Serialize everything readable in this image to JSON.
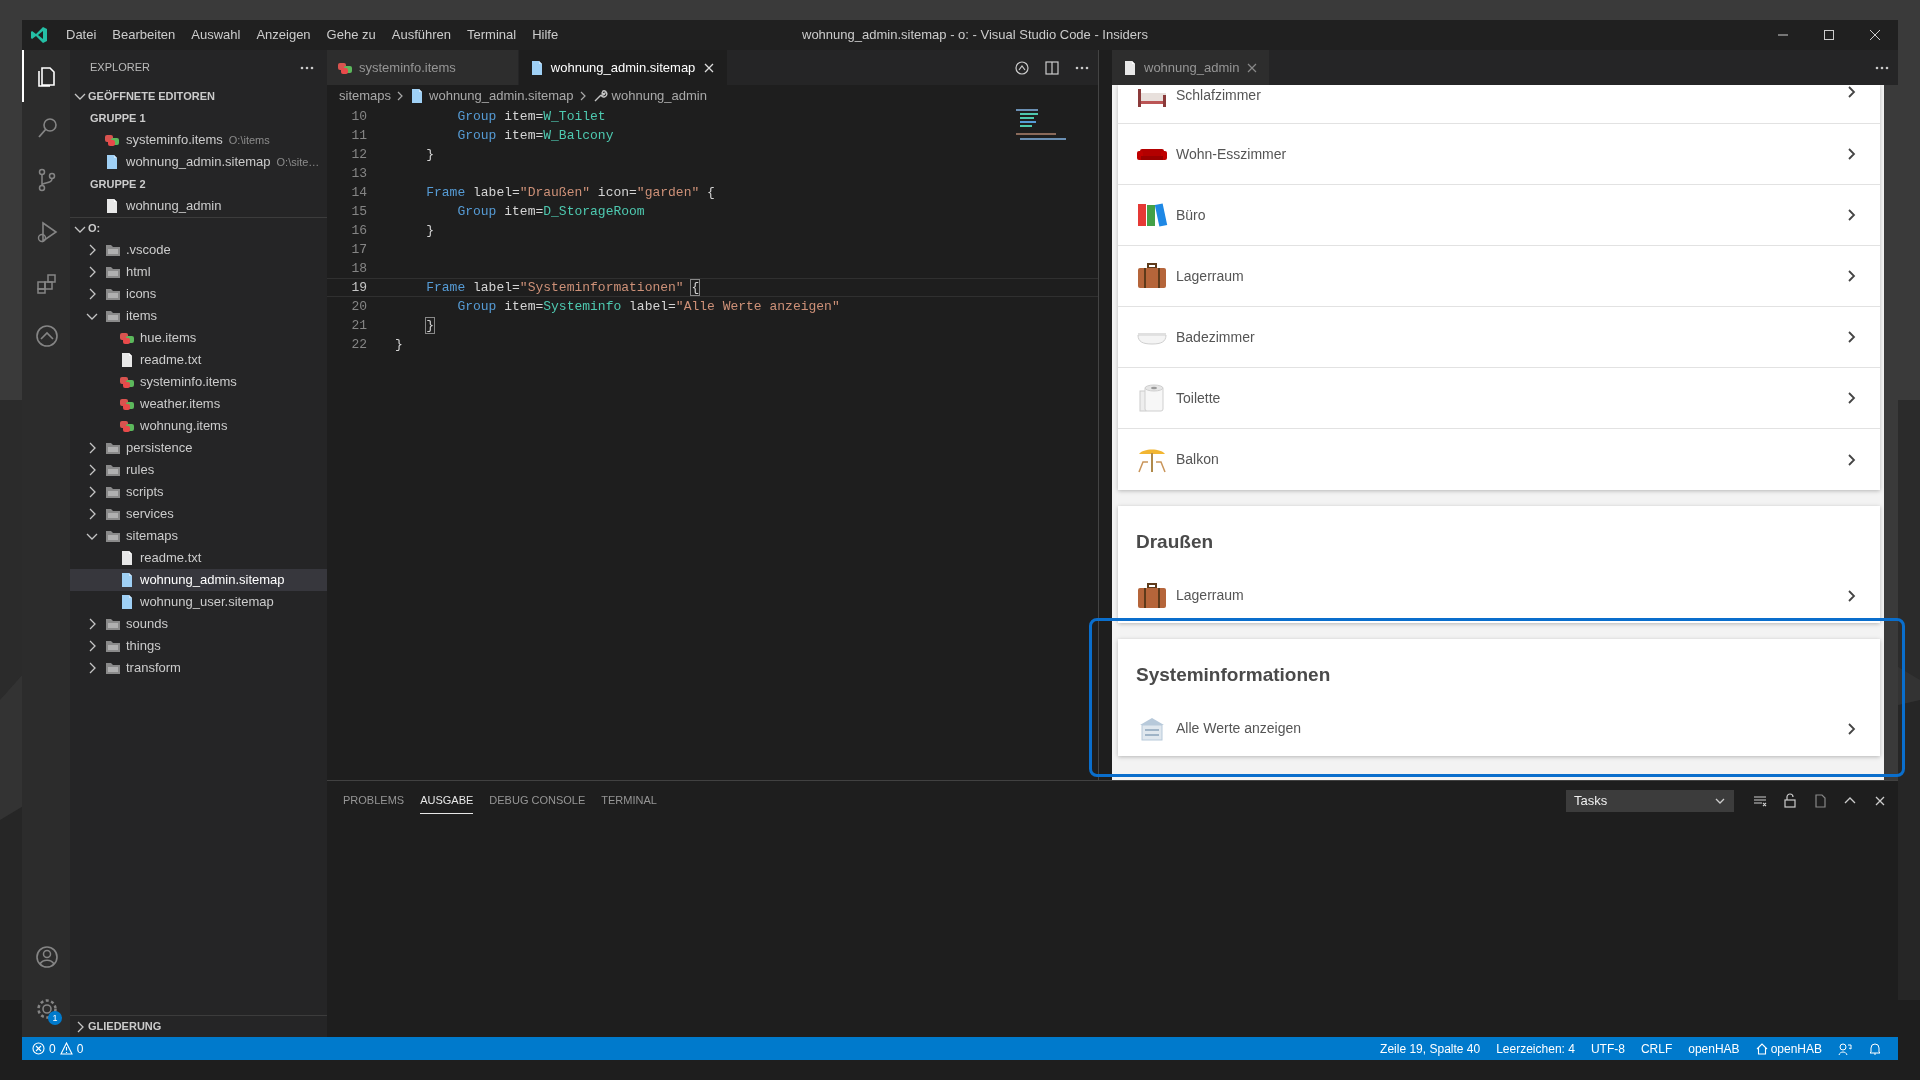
{
  "window": {
    "title": "wohnung_admin.sitemap - o: - Visual Studio Code - Insiders",
    "menu": [
      "Datei",
      "Bearbeiten",
      "Auswahl",
      "Anzeigen",
      "Gehe zu",
      "Ausführen",
      "Terminal",
      "Hilfe"
    ]
  },
  "activity_bar": {
    "top": [
      {
        "kind": "explorer",
        "selected": true
      },
      {
        "kind": "search",
        "selected": false
      },
      {
        "kind": "source-control",
        "selected": false
      },
      {
        "kind": "run",
        "selected": false
      },
      {
        "kind": "extensions",
        "selected": false
      },
      {
        "kind": "openhab",
        "selected": false
      }
    ],
    "bottom": [
      {
        "kind": "accounts"
      },
      {
        "kind": "settings",
        "badge": "1"
      }
    ]
  },
  "sidebar": {
    "title": "EXPLORER",
    "open_editors": {
      "title": "GEÖFFNETE EDITOREN",
      "expanded": true,
      "groups": [
        {
          "title": "GRUPPE 1",
          "files": [
            {
              "name": "systeminfo.items",
              "path": "O:\\items",
              "kind": "items"
            },
            {
              "name": "wohnung_admin.sitemap",
              "path": "O:\\site…",
              "kind": "sitemap"
            }
          ]
        },
        {
          "title": "GRUPPE 2",
          "files": [
            {
              "name": "wohnung_admin",
              "kind": "page"
            }
          ]
        }
      ]
    },
    "folder": {
      "title": "O:",
      "expanded": true,
      "items": [
        {
          "name": ".vscode",
          "kind": "folder",
          "expanded": false,
          "selected": false
        },
        {
          "name": "html",
          "kind": "folder",
          "expanded": false,
          "selected": false
        },
        {
          "name": "icons",
          "kind": "folder",
          "expanded": false,
          "selected": false
        },
        {
          "name": "items",
          "kind": "folder",
          "expanded": true,
          "selected": false,
          "children": [
            {
              "name": "hue.items",
              "kind": "items",
              "selected": false
            },
            {
              "name": "readme.txt",
              "kind": "page",
              "selected": false
            },
            {
              "name": "systeminfo.items",
              "kind": "items",
              "selected": false
            },
            {
              "name": "weather.items",
              "kind": "items",
              "selected": false
            },
            {
              "name": "wohnung.items",
              "kind": "items",
              "selected": false
            }
          ]
        },
        {
          "name": "persistence",
          "kind": "folder",
          "expanded": false,
          "selected": false
        },
        {
          "name": "rules",
          "kind": "folder",
          "expanded": false,
          "selected": false
        },
        {
          "name": "scripts",
          "kind": "folder",
          "expanded": false,
          "selected": false
        },
        {
          "name": "services",
          "kind": "folder",
          "expanded": false,
          "selected": false
        },
        {
          "name": "sitemaps",
          "kind": "folder",
          "expanded": true,
          "selected": false,
          "children": [
            {
              "name": "readme.txt",
              "kind": "page",
              "selected": false
            },
            {
              "name": "wohnung_admin.sitemap",
              "kind": "sitemap",
              "selected": true
            },
            {
              "name": "wohnung_user.sitemap",
              "kind": "sitemap",
              "selected": false
            }
          ]
        },
        {
          "name": "sounds",
          "kind": "folder",
          "expanded": false,
          "selected": false
        },
        {
          "name": "things",
          "kind": "folder",
          "expanded": false,
          "selected": false
        },
        {
          "name": "transform",
          "kind": "folder",
          "expanded": false,
          "selected": false
        }
      ]
    },
    "outline": {
      "title": "GLIEDERUNG",
      "expanded": false
    }
  },
  "editor": {
    "tabs": [
      {
        "label": "systeminfo.items",
        "kind": "items",
        "selected": false
      },
      {
        "label": "wohnung_admin.sitemap",
        "kind": "sitemap",
        "selected": true
      }
    ],
    "breadcrumb": [
      {
        "label": "sitemaps",
        "kind": "folder"
      },
      {
        "label": "wohnung_admin.sitemap",
        "kind": "sitemap"
      },
      {
        "label": "wohnung_admin",
        "kind": "symbol"
      }
    ],
    "lines": [
      {
        "number": "10",
        "current": false,
        "tokens": [
          {
            "text": "        Group",
            "kind": "keyword"
          },
          {
            "text": " item=",
            "kind": "plain"
          },
          {
            "text": "W_Toilet",
            "kind": "item"
          }
        ]
      },
      {
        "number": "11",
        "current": false,
        "tokens": [
          {
            "text": "        Group",
            "kind": "keyword"
          },
          {
            "text": " item=",
            "kind": "plain"
          },
          {
            "text": "W_Balcony",
            "kind": "item"
          }
        ]
      },
      {
        "number": "12",
        "current": false,
        "tokens": [
          {
            "text": "    }",
            "kind": "plain"
          }
        ]
      },
      {
        "number": "13",
        "current": false
      },
      {
        "number": "14",
        "current": false,
        "tokens": [
          {
            "text": "    Frame",
            "kind": "keyword"
          },
          {
            "text": " label=",
            "kind": "plain"
          },
          {
            "text": "\"Draußen\"",
            "kind": "string"
          },
          {
            "text": " icon=",
            "kind": "plain"
          },
          {
            "text": "\"garden\"",
            "kind": "string"
          },
          {
            "text": " {",
            "kind": "plain"
          }
        ]
      },
      {
        "number": "15",
        "current": false,
        "tokens": [
          {
            "text": "        Group",
            "kind": "keyword"
          },
          {
            "text": " item=",
            "kind": "plain"
          },
          {
            "text": "D_StorageRoom",
            "kind": "item"
          }
        ]
      },
      {
        "number": "16",
        "current": false,
        "tokens": [
          {
            "text": "    }",
            "kind": "plain"
          }
        ]
      },
      {
        "number": "17",
        "current": false
      },
      {
        "number": "18",
        "current": false
      },
      {
        "number": "19",
        "current": true,
        "tokens": [
          {
            "text": "    Frame",
            "kind": "keyword"
          },
          {
            "text": " label=",
            "kind": "plain"
          },
          {
            "text": "\"Systeminformationen\"",
            "kind": "string"
          },
          {
            "text": " {",
            "kind": "bracket"
          }
        ]
      },
      {
        "number": "20",
        "current": false,
        "tokens": [
          {
            "text": "        Group",
            "kind": "keyword"
          },
          {
            "text": " item=",
            "kind": "plain"
          },
          {
            "text": "Systeminfo",
            "kind": "item"
          },
          {
            "text": " label=",
            "kind": "plain"
          },
          {
            "text": "\"Alle Werte anzeigen\"",
            "kind": "string"
          }
        ]
      },
      {
        "number": "21",
        "current": false,
        "tokens": [
          {
            "text": "    }",
            "kind": "bracket"
          }
        ]
      },
      {
        "number": "22",
        "current": false,
        "tokens": [
          {
            "text": "}",
            "kind": "plain"
          }
        ]
      }
    ]
  },
  "preview": {
    "tab": {
      "label": "wohnung_admin"
    },
    "sections": [
      {
        "highlighted": false,
        "items": [
          {
            "label": "Schlafzimmer",
            "kind": "bed"
          },
          {
            "label": "Wohn-Esszimmer",
            "kind": "sofa"
          },
          {
            "label": "Büro",
            "kind": "binders"
          },
          {
            "label": "Lagerraum",
            "kind": "suitcase"
          },
          {
            "label": "Badezimmer",
            "kind": "bathtub"
          },
          {
            "label": "Toilette",
            "kind": "toilet-roll"
          },
          {
            "label": "Balkon",
            "kind": "parasol"
          }
        ]
      },
      {
        "title": "Draußen",
        "highlighted": false,
        "items": [
          {
            "label": "Lagerraum",
            "kind": "suitcase"
          }
        ]
      },
      {
        "title": "Systeminformationen",
        "highlighted": true,
        "items": [
          {
            "label": "Alle Werte anzeigen",
            "kind": "server"
          }
        ]
      }
    ]
  },
  "panel": {
    "tabs": [
      {
        "label": "PROBLEMS",
        "selected": false
      },
      {
        "label": "AUSGABE",
        "selected": true
      },
      {
        "label": "DEBUG CONSOLE",
        "selected": false
      },
      {
        "label": "TERMINAL",
        "selected": false
      }
    ],
    "dropdown": {
      "value": "Tasks"
    }
  },
  "status_bar": {
    "errors": "0",
    "warnings": "0",
    "items": [
      {
        "label": "Zeile 19, Spalte 40"
      },
      {
        "label": "Leerzeichen: 4"
      },
      {
        "label": "UTF-8"
      },
      {
        "label": "CRLF"
      },
      {
        "label": "openHAB",
        "kind": "text"
      },
      {
        "label": "openHAB",
        "kind": "home"
      }
    ]
  }
}
